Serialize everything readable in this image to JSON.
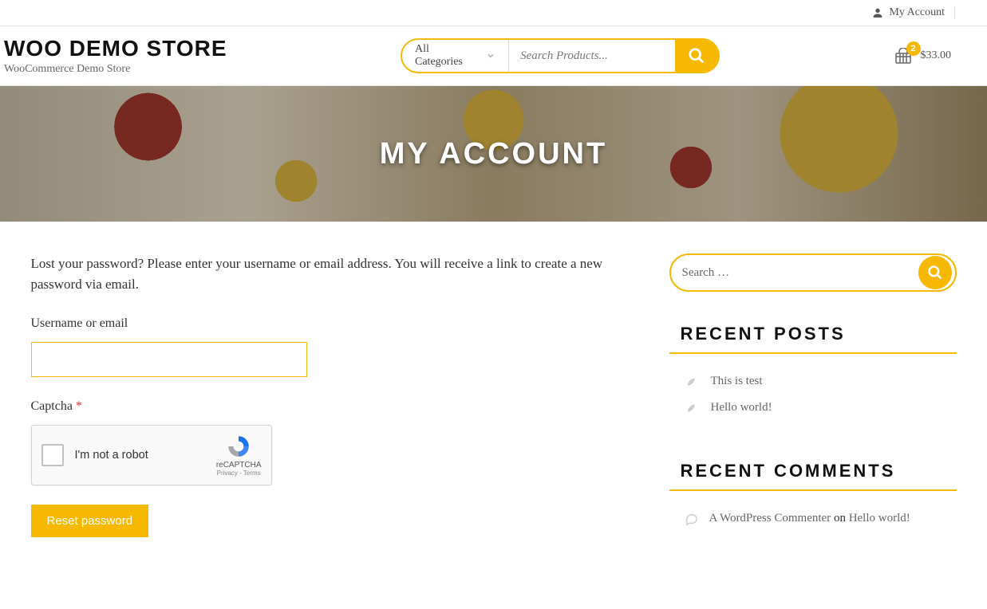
{
  "topbar": {
    "account_label": "My Account"
  },
  "brand": {
    "title": "WOO DEMO STORE",
    "tagline": "WooCommerce Demo Store"
  },
  "search": {
    "category_label": "All Categories",
    "placeholder": "Search Products..."
  },
  "cart": {
    "count": "2",
    "total": "$33.00"
  },
  "hero": {
    "title": "MY ACCOUNT"
  },
  "form": {
    "intro": "Lost your password? Please enter your username or email address. You will receive a link to create a new password via email.",
    "username_label": "Username or email",
    "captcha_label": "Captcha ",
    "captcha_required": "*",
    "captcha_text": "I'm not a robot",
    "captcha_brand": "reCAPTCHA",
    "captcha_legal": "Privacy - Terms",
    "submit_label": "Reset password"
  },
  "sidebar": {
    "search_placeholder": "Search …",
    "recent_posts_title": "RECENT POSTS",
    "posts": [
      {
        "title": "This is test"
      },
      {
        "title": "Hello world!"
      }
    ],
    "recent_comments_title": "RECENT COMMENTS",
    "comments": [
      {
        "author": "A WordPress Commenter",
        "on_text": " on ",
        "post": "Hello world!"
      }
    ]
  }
}
